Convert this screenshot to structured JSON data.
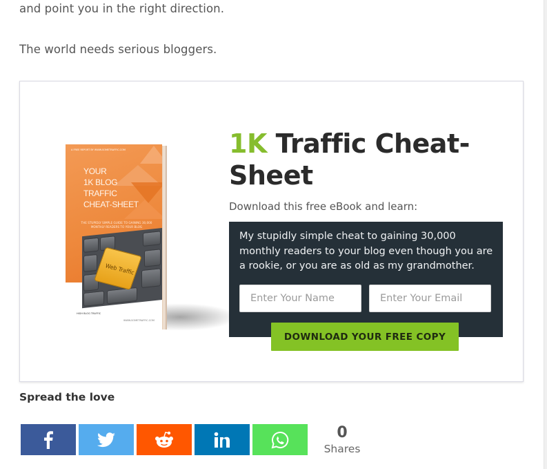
{
  "article": {
    "para1": "and point you in the right direction.",
    "para2": "The world needs serious bloggers."
  },
  "optin": {
    "book": {
      "publisher_line": "A FREE REPORT BY WWW.SOMETRAFFIC.COM",
      "cover_title_lines": [
        "YOUR",
        "1K BLOG",
        "TRAFFIC",
        "CHEAT-SHEET"
      ],
      "cover_subtitle": "THE STUPIDLY SIMPLE GUIDE TO GAINING 30,000 MONTHLY READERS TO YOUR BLOG",
      "key_label": "Web Traffic",
      "footer_left": "HIGH BLOG TRAFFIC",
      "footer_right": "WWW.SOMETRAFFIC.COM"
    },
    "headline_accent": "1K",
    "headline_rest": " Traffic Cheat-Sheet",
    "subline": "Download this free eBook and learn:",
    "panel_text": "My stupidly simple cheat to gaining 30,000 monthly readers to your blog even though you are a rookie, or you are as old as my grandmother.",
    "name_placeholder": "Enter Your Name",
    "email_placeholder": "Enter Your Email",
    "button_label": "DOWNLOAD YOUR FREE COPY",
    "colors": {
      "accent_green": "#86bd2e",
      "panel_bg": "#253038",
      "button_bg": "#84c225",
      "book_orange": "#ee8a3e"
    }
  },
  "share": {
    "heading": "Spread the love",
    "buttons": [
      {
        "network": "facebook",
        "icon": "facebook-icon",
        "color": "#3b5a9a"
      },
      {
        "network": "twitter",
        "icon": "twitter-icon",
        "color": "#55acee"
      },
      {
        "network": "reddit",
        "icon": "reddit-icon",
        "color": "#ff5700"
      },
      {
        "network": "linkedin",
        "icon": "linkedin-icon",
        "color": "#0077b5"
      },
      {
        "network": "whatsapp",
        "icon": "whatsapp-icon",
        "color": "#57e25a"
      }
    ],
    "count": "0",
    "count_label": "Shares"
  }
}
